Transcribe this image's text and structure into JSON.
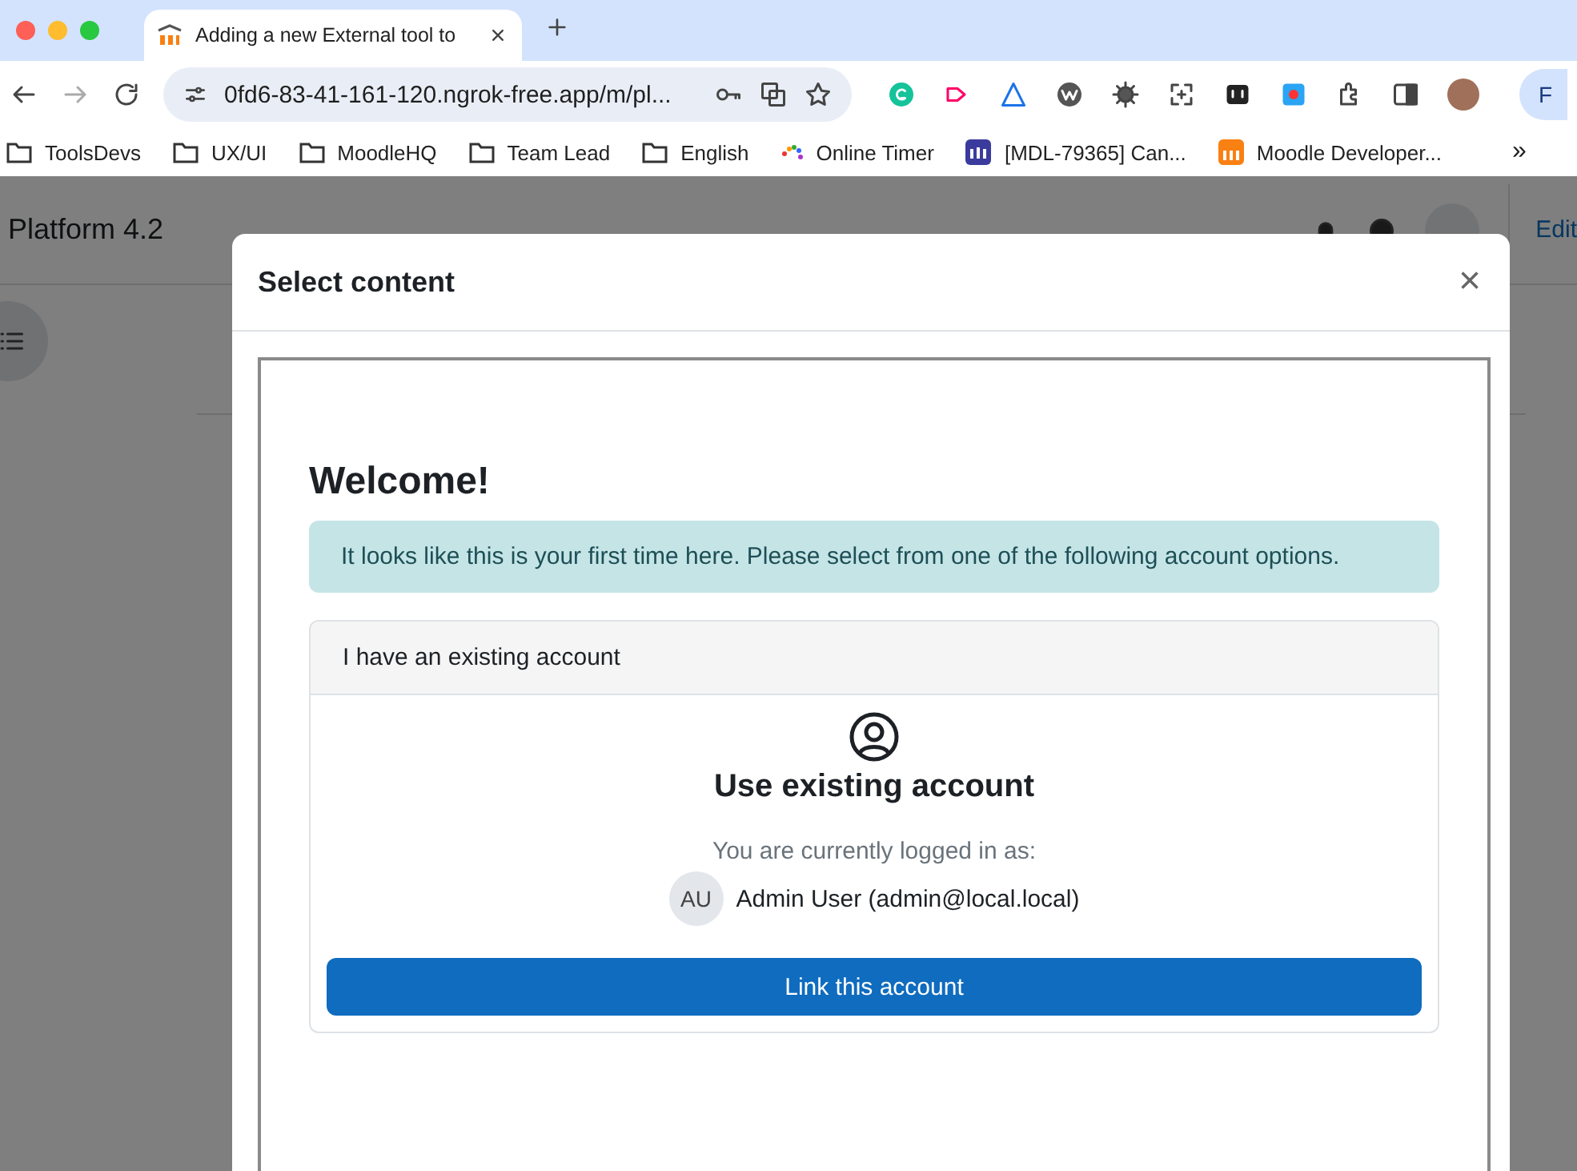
{
  "browser": {
    "tab": {
      "title": "Adding a new External tool to"
    },
    "address": "0fd6-83-41-161-120.ngrok-free.app/m/pl...",
    "profile_button": "F",
    "bookmarks": [
      {
        "label": "ToolsDevs",
        "kind": "folder"
      },
      {
        "label": "UX/UI",
        "kind": "folder"
      },
      {
        "label": "MoodleHQ",
        "kind": "folder"
      },
      {
        "label": "Team Lead",
        "kind": "folder"
      },
      {
        "label": "English",
        "kind": "folder"
      },
      {
        "label": "Online Timer",
        "kind": "dots"
      },
      {
        "label": "[MDL-79365] Can...",
        "kind": "tracker"
      },
      {
        "label": "Moodle Developer...",
        "kind": "moodle"
      }
    ],
    "more": "»"
  },
  "site": {
    "brand": "Platform 4.2",
    "edit": "Edit"
  },
  "modal": {
    "title": "Select content",
    "close": "×",
    "heading": "Welcome!",
    "alert": "It looks like this is your first time here. Please select from one of the following account options.",
    "card": {
      "header": "I have an existing account",
      "title": "Use existing account",
      "note": "You are currently logged in as:",
      "avatar": "AU",
      "user": "Admin User (admin@local.local)",
      "button": "Link this account"
    }
  }
}
